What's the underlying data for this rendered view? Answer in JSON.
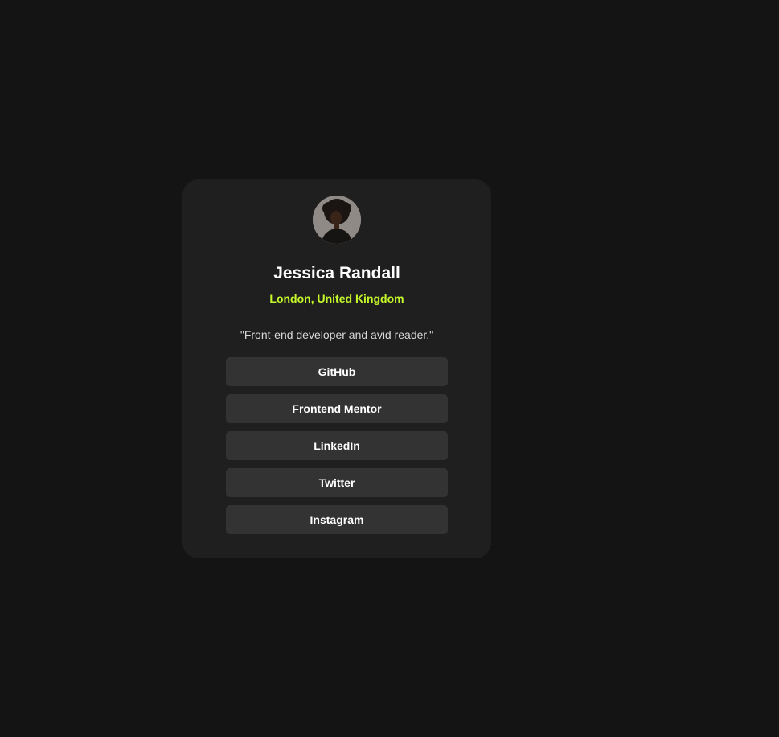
{
  "profile": {
    "avatar_icon": "profile-photo",
    "name": "Jessica Randall",
    "location": "London, United Kingdom",
    "bio": "\"Front-end developer and avid reader.\""
  },
  "links": [
    {
      "label": "GitHub"
    },
    {
      "label": "Frontend Mentor"
    },
    {
      "label": "LinkedIn"
    },
    {
      "label": "Twitter"
    },
    {
      "label": "Instagram"
    }
  ],
  "colors": {
    "page_background": "#141414",
    "card_background": "#1f1f1f",
    "button_background": "#333333",
    "accent": "#c4f82a",
    "text": "#ffffff"
  }
}
